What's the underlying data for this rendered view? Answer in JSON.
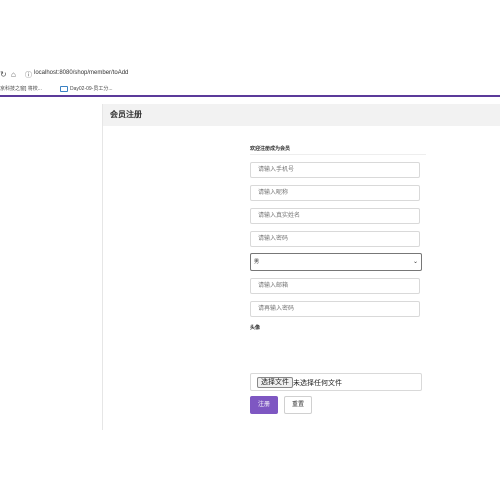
{
  "browser": {
    "url": "localhost:8080/shop/member/toAdd",
    "bookmarks": [
      {
        "label": "京科技之窗] 将校..."
      },
      {
        "label": "Day02-09-员工分..."
      }
    ]
  },
  "page": {
    "title": "会员注册"
  },
  "form": {
    "subtitle": "欢迎注册成为会员",
    "fields": {
      "phone_placeholder": "请输入手机号",
      "nickname_placeholder": "请输入昵称",
      "realname_placeholder": "请输入真实姓名",
      "password_placeholder": "请输入密码",
      "gender_selected": "男",
      "email_placeholder": "请输入邮箱",
      "confirm_password_placeholder": "请再输入密码"
    },
    "avatar_label": "头像",
    "file_button": "选择文件",
    "file_status": "未选择任何文件",
    "submit_label": "注册",
    "reset_label": "重置"
  },
  "colors": {
    "accent": "#7e57c2",
    "browser_accent_line": "#5b3a9a"
  }
}
